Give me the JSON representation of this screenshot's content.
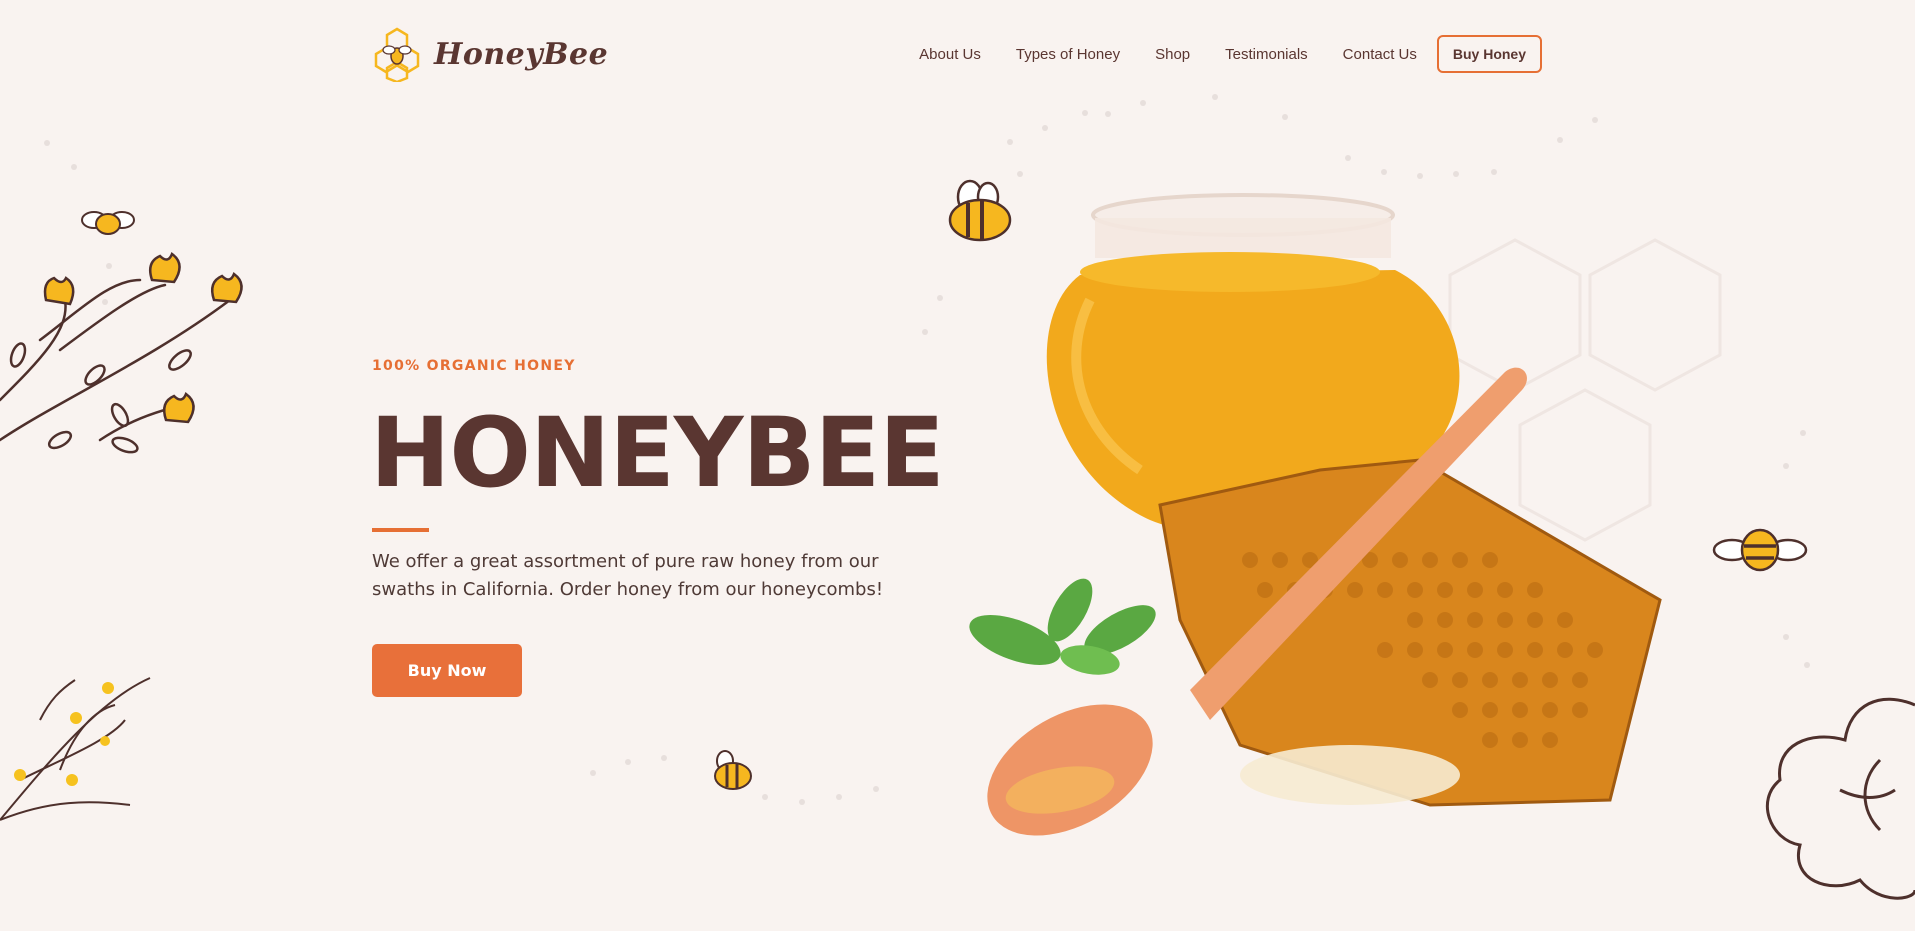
{
  "brand": {
    "name": "HoneyBee"
  },
  "nav": {
    "links": [
      "About Us",
      "Types of Honey",
      "Shop",
      "Testimonials",
      "Contact Us"
    ],
    "cta": "Buy Honey"
  },
  "hero": {
    "eyebrow": "100% ORGANIC HONEY",
    "title": "HONEYBEE",
    "description": "We offer a great assortment of pure raw honey from our swaths in California. Order honey from our honeycombs!",
    "button": "Buy Now"
  },
  "colors": {
    "background": "#f9f3f0",
    "primary": "#e66f34",
    "text": "#5a3631",
    "honey": "#f2a91c"
  },
  "icons": [
    "honeycomb-logo-icon",
    "bee-icon",
    "flower-branch-icon",
    "flower-icon",
    "honey-jar-icon",
    "honeycomb-icon",
    "wooden-spoon-icon",
    "mint-leaf-icon"
  ]
}
